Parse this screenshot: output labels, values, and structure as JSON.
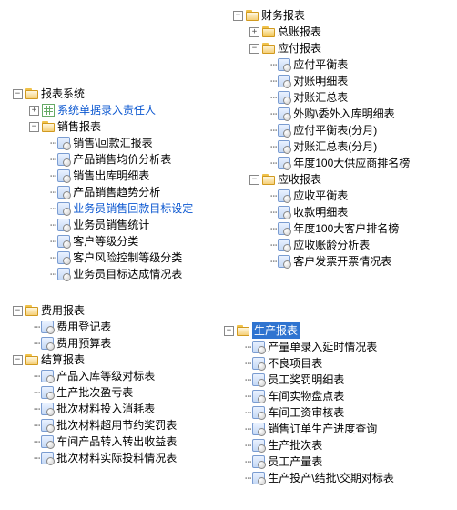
{
  "t": {
    "root": "报表系统",
    "sys": "系统单据录入责任人",
    "sales": "销售报表",
    "sales_items": [
      "销售\\回款汇报表",
      "产品销售均价分析表",
      "销售出库明细表",
      "产品销售趋势分析",
      "业务员销售回款目标设定",
      "业务员销售统计",
      "客户等级分类",
      "客户风险控制等级分类",
      "业务员目标达成情况表"
    ],
    "fee": "费用报表",
    "fee_items": [
      "费用登记表",
      "费用预算表"
    ],
    "settle": "结算报表",
    "settle_items": [
      "产品入库等级对标表",
      "生产批次盈亏表",
      "批次材料投入消耗表",
      "批次材料超用节约奖罚表",
      "车间产品转入转出收益表",
      "批次材料实际投料情况表"
    ],
    "fin": "财务报表",
    "gl": "总账报表",
    "ap": "应付报表",
    "ap_items": [
      "应付平衡表",
      "对账明细表",
      "对账汇总表",
      "外购\\委外入库明细表",
      "应付平衡表(分月)",
      "对账汇总表(分月)",
      "年度100大供应商排名榜"
    ],
    "ar": "应收报表",
    "ar_items": [
      "应收平衡表",
      "收款明细表",
      "年度100大客户排名榜",
      "应收账龄分析表",
      "客户发票开票情况表"
    ],
    "prod": "生产报表",
    "prod_items": [
      "产量单录入延时情况表",
      "不良项目表",
      "员工奖罚明细表",
      "车间实物盘点表",
      "车间工资审核表",
      "销售订单生产进度查询",
      "生产批次表",
      "员工产量表",
      "生产投产\\结批\\交期对标表"
    ]
  }
}
